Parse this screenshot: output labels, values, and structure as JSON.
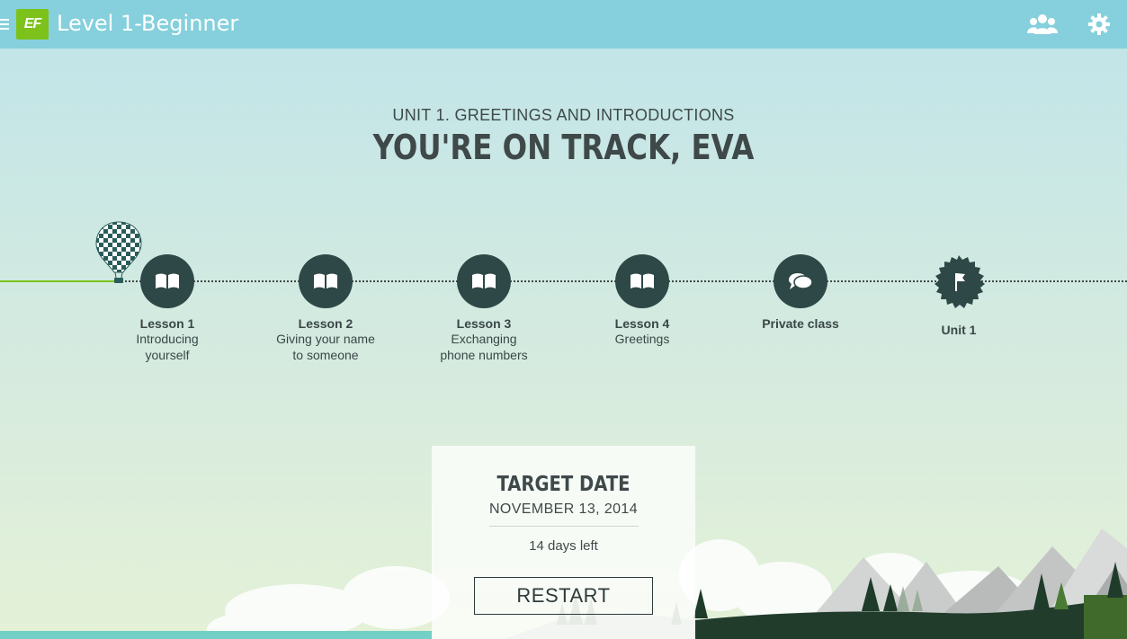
{
  "header": {
    "logo_text": "EF",
    "title": "Level 1-Beginner",
    "icons": [
      "menu-icon",
      "people-icon",
      "gear-icon"
    ]
  },
  "unit": {
    "label": "UNIT 1. GREETINGS AND INTRODUCTIONS",
    "headline": "YOU'RE ON TRACK, EVA"
  },
  "track": {
    "steps": [
      {
        "title": "Lesson 1",
        "lines": [
          "Introducing",
          "yourself"
        ],
        "icon": "book-icon"
      },
      {
        "title": "Lesson 2",
        "lines": [
          "Giving your name",
          "to someone"
        ],
        "icon": "book-icon"
      },
      {
        "title": "Lesson 3",
        "lines": [
          "Exchanging",
          "phone numbers"
        ],
        "icon": "book-icon"
      },
      {
        "title": "Lesson 4",
        "lines": [
          "Greetings"
        ],
        "icon": "book-icon"
      },
      {
        "title": "Private class",
        "lines": [],
        "icon": "chat-icon"
      },
      {
        "title": "Unit 1",
        "lines": [],
        "icon": "flag-icon"
      }
    ],
    "current_marker": "balloon-icon"
  },
  "target": {
    "title": "TARGET DATE",
    "date": "NOVEMBER 13, 2014",
    "days_left": "14 days left",
    "restart_label": "RESTART"
  },
  "colors": {
    "header": "#85d0dc",
    "accent_green": "#7cc21b",
    "node_dark": "#2e4847",
    "text": "#3f4949"
  }
}
